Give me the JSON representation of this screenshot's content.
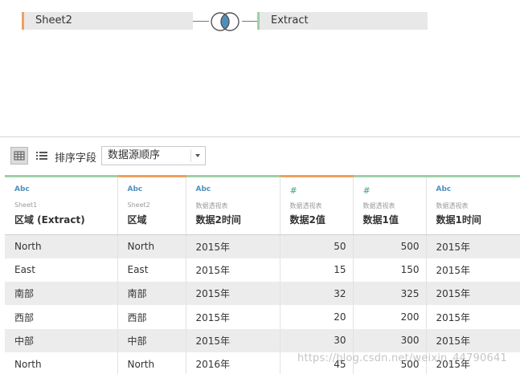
{
  "join": {
    "left_table": "Sheet2",
    "right_table": "Extract",
    "join_type_icon": "venn-inner-join-icon"
  },
  "toolbar": {
    "sort_label": "排序字段",
    "sort_value": "数据源顺序"
  },
  "columns": [
    {
      "type": "Abc",
      "source": "Sheet1",
      "name": "区域 (Extract)",
      "align": "left"
    },
    {
      "type": "Abc",
      "source": "Sheet2",
      "name": "区域",
      "align": "left"
    },
    {
      "type": "Abc",
      "source": "数据透视表",
      "name": "数据2时间",
      "align": "left"
    },
    {
      "type": "#",
      "source": "数据透视表",
      "name": "数据2值",
      "align": "right"
    },
    {
      "type": "#",
      "source": "数据透视表",
      "name": "数据1值",
      "align": "right"
    },
    {
      "type": "Abc",
      "source": "数据透视表",
      "name": "数据1时间",
      "align": "left"
    }
  ],
  "rows": [
    [
      "North",
      "North",
      "2015年",
      "50",
      "500",
      "2015年"
    ],
    [
      "East",
      "East",
      "2015年",
      "15",
      "150",
      "2015年"
    ],
    [
      "南部",
      "南部",
      "2015年",
      "32",
      "325",
      "2015年"
    ],
    [
      "西部",
      "西部",
      "2015年",
      "20",
      "200",
      "2015年"
    ],
    [
      "中部",
      "中部",
      "2015年",
      "30",
      "300",
      "2015年"
    ],
    [
      "North",
      "North",
      "2016年",
      "45",
      "500",
      "2015年"
    ]
  ],
  "watermark": "https://blog.csdn.net/weixin_44790641",
  "colors": {
    "sheet_accent": "#f0a05c",
    "extract_accent": "#9fd0a8",
    "venn_fill": "#4f8fbe",
    "row_stripe": "#ececec"
  }
}
